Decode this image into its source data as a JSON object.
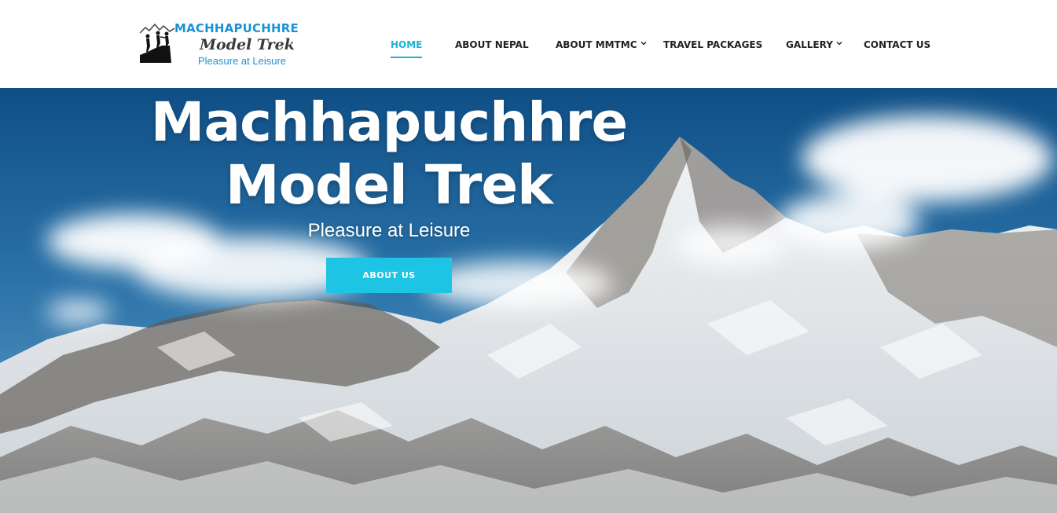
{
  "logo": {
    "title": "MACHHAPUCHHRE",
    "script": "Model Trek",
    "tagline": "Pleasure at Leisure",
    "icon": "hikers-mountain-icon",
    "colors": {
      "title": "#1a93d6",
      "script": "#3a3a3a"
    }
  },
  "nav": {
    "items": [
      {
        "label": "HOME",
        "active": true
      },
      {
        "label": "ABOUT NEPAL"
      },
      {
        "label": "ABOUT MMTMC",
        "dropdown": true
      },
      {
        "label": "TRAVEL PACKAGES"
      },
      {
        "label": "GALLERY",
        "dropdown": true
      },
      {
        "label": "CONTACT US"
      }
    ],
    "active_color": "#1fb3d6",
    "icons": {
      "dropdown": "chevron-down-icon"
    }
  },
  "hero": {
    "title_line1": "Machhapuchhre",
    "title_line2": "Model Trek",
    "subtitle": "Pleasure at Leisure",
    "button_label": "ABOUT US",
    "button_color": "#1ec4e4",
    "sky_color": "#1d5f96"
  }
}
